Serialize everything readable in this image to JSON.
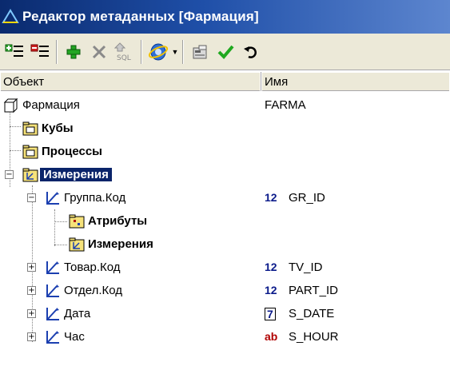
{
  "window": {
    "title": "Редактор метаданных [Фармация]"
  },
  "toolbar": {
    "buttons": [
      {
        "name": "add-level-icon"
      },
      {
        "name": "remove-level-icon"
      },
      {
        "name": "add-icon"
      },
      {
        "name": "delete-icon"
      },
      {
        "name": "sql-icon",
        "text": "SQL"
      },
      {
        "name": "ie-icon"
      },
      {
        "name": "properties-icon"
      },
      {
        "name": "check-icon"
      },
      {
        "name": "undo-icon"
      }
    ]
  },
  "columns": {
    "object": "Объект",
    "name": "Имя"
  },
  "tree": {
    "root": {
      "label": "Фармация",
      "value": "FARMA"
    },
    "cubes": {
      "label": "Кубы"
    },
    "processes": {
      "label": "Процессы"
    },
    "dimensions": {
      "label": "Измерения"
    },
    "group": {
      "label": "Группа.Код",
      "type": "12",
      "value": "GR_ID"
    },
    "attributes": {
      "label": "Атрибуты"
    },
    "sub_dimensions": {
      "label": "Измерения"
    },
    "product": {
      "label": "Товар.Код",
      "type": "12",
      "value": "TV_ID"
    },
    "department": {
      "label": "Отдел.Код",
      "type": "12",
      "value": "PART_ID"
    },
    "date": {
      "label": "Дата",
      "type": "7",
      "value": "S_DATE"
    },
    "hour": {
      "label": "Час",
      "type": "ab",
      "value": "S_HOUR"
    }
  },
  "colors": {
    "titlebar": "#0a2a6e",
    "selection": "#0a246a",
    "type_number": "#0a1a8a",
    "type_text": "#b00000"
  }
}
